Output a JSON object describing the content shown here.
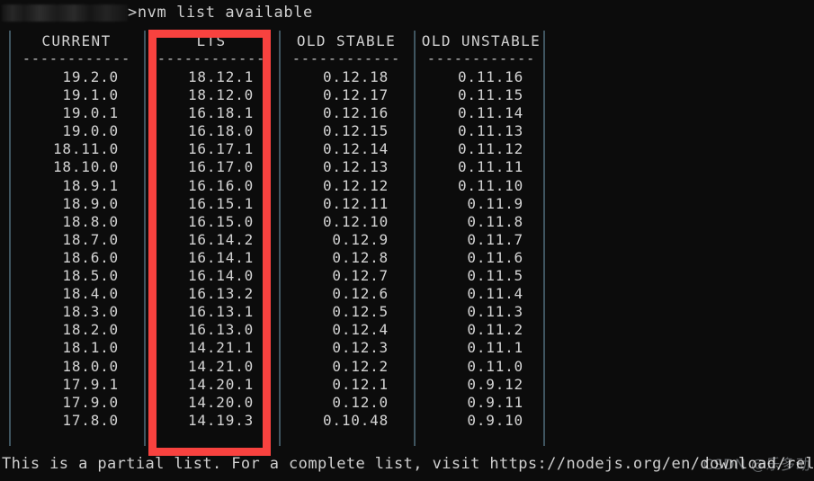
{
  "prompt": {
    "redacted_path": "C:\\Users\\████████",
    "separator": ">",
    "command": "nvm list available"
  },
  "table": {
    "columns": [
      {
        "header": "CURRENT",
        "dashes": "------------",
        "highlighted": false,
        "versions": [
          "19.2.0",
          "19.1.0",
          "19.0.1",
          "19.0.0",
          "18.11.0",
          "18.10.0",
          "18.9.1",
          "18.9.0",
          "18.8.0",
          "18.7.0",
          "18.6.0",
          "18.5.0",
          "18.4.0",
          "18.3.0",
          "18.2.0",
          "18.1.0",
          "18.0.0",
          "17.9.1",
          "17.9.0",
          "17.8.0"
        ]
      },
      {
        "header": "LTS",
        "dashes": "------------",
        "highlighted": true,
        "versions": [
          "18.12.1",
          "18.12.0",
          "16.18.1",
          "16.18.0",
          "16.17.1",
          "16.17.0",
          "16.16.0",
          "16.15.1",
          "16.15.0",
          "16.14.2",
          "16.14.1",
          "16.14.0",
          "16.13.2",
          "16.13.1",
          "16.13.0",
          "14.21.1",
          "14.21.0",
          "14.20.1",
          "14.20.0",
          "14.19.3"
        ]
      },
      {
        "header": "OLD STABLE",
        "dashes": "------------",
        "highlighted": false,
        "versions": [
          "0.12.18",
          "0.12.17",
          "0.12.16",
          "0.12.15",
          "0.12.14",
          "0.12.13",
          "0.12.12",
          "0.12.11",
          "0.12.10",
          "0.12.9",
          "0.12.8",
          "0.12.7",
          "0.12.6",
          "0.12.5",
          "0.12.4",
          "0.12.3",
          "0.12.2",
          "0.12.1",
          "0.12.0",
          "0.10.48"
        ]
      },
      {
        "header": "OLD UNSTABLE",
        "dashes": "------------",
        "highlighted": false,
        "versions": [
          "0.11.16",
          "0.11.15",
          "0.11.14",
          "0.11.13",
          "0.11.12",
          "0.11.11",
          "0.11.10",
          "0.11.9",
          "0.11.8",
          "0.11.7",
          "0.11.6",
          "0.11.5",
          "0.11.4",
          "0.11.3",
          "0.11.2",
          "0.11.1",
          "0.11.0",
          "0.9.12",
          "0.9.11",
          "0.9.10"
        ]
      }
    ]
  },
  "footer": {
    "message": "This is a partial list. For a complete list, visit https://nodejs.org/en/download/releases"
  },
  "watermark": {
    "text": "CSDN @乐多动"
  },
  "colors": {
    "background": "#0c0c0c",
    "text": "#d4d4d4",
    "rule": "#3f5560",
    "highlight": "#f8423f"
  }
}
